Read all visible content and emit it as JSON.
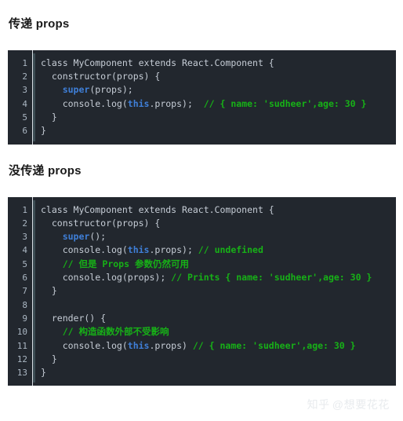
{
  "sections": [
    {
      "heading": "传递 props",
      "code": {
        "line_numbers": [
          "1",
          "2",
          "3",
          "4",
          "5",
          "6"
        ],
        "lines": [
          [
            {
              "t": "class MyComponent extends React.Component {",
              "c": "plain"
            }
          ],
          [
            {
              "t": "  constructor(props) {",
              "c": "plain"
            }
          ],
          [
            {
              "t": "    ",
              "c": "plain"
            },
            {
              "t": "super",
              "c": "kw"
            },
            {
              "t": "(props);",
              "c": "plain"
            }
          ],
          [
            {
              "t": "    console.log(",
              "c": "plain"
            },
            {
              "t": "this",
              "c": "kw"
            },
            {
              "t": ".props);  ",
              "c": "plain"
            },
            {
              "t": "// { name: 'sudheer',age: 30 }",
              "c": "cmt"
            }
          ],
          [
            {
              "t": "  }",
              "c": "plain"
            }
          ],
          [
            {
              "t": "}",
              "c": "plain"
            }
          ]
        ]
      }
    },
    {
      "heading": "没传递 props",
      "code": {
        "line_numbers": [
          "1",
          "2",
          "3",
          "4",
          "5",
          "6",
          "7",
          "8",
          "9",
          "10",
          "11",
          "12",
          "13"
        ],
        "lines": [
          [
            {
              "t": "class MyComponent extends React.Component {",
              "c": "plain"
            }
          ],
          [
            {
              "t": "  constructor(props) {",
              "c": "plain"
            }
          ],
          [
            {
              "t": "    ",
              "c": "plain"
            },
            {
              "t": "super",
              "c": "kw"
            },
            {
              "t": "();",
              "c": "plain"
            }
          ],
          [
            {
              "t": "    console.log(",
              "c": "plain"
            },
            {
              "t": "this",
              "c": "kw"
            },
            {
              "t": ".props); ",
              "c": "plain"
            },
            {
              "t": "// undefined",
              "c": "cmt"
            }
          ],
          [
            {
              "t": "    ",
              "c": "plain"
            },
            {
              "t": "// 但是 Props 参数仍然可用",
              "c": "cmt"
            }
          ],
          [
            {
              "t": "    console.log(props); ",
              "c": "plain"
            },
            {
              "t": "// Prints { name: 'sudheer',age: 30 }",
              "c": "cmt"
            }
          ],
          [
            {
              "t": "  }",
              "c": "plain"
            }
          ],
          [
            {
              "t": "",
              "c": "plain"
            }
          ],
          [
            {
              "t": "  render() {",
              "c": "plain"
            }
          ],
          [
            {
              "t": "    ",
              "c": "plain"
            },
            {
              "t": "// 构造函数外部不受影响",
              "c": "cmt"
            }
          ],
          [
            {
              "t": "    console.log(",
              "c": "plain"
            },
            {
              "t": "this",
              "c": "kw"
            },
            {
              "t": ".props) ",
              "c": "plain"
            },
            {
              "t": "// { name: 'sudheer',age: 30 }",
              "c": "cmt"
            }
          ],
          [
            {
              "t": "  }",
              "c": "plain"
            }
          ],
          [
            {
              "t": "}",
              "c": "plain"
            }
          ]
        ]
      }
    }
  ],
  "watermark": {
    "brand": "知乎",
    "user": "@想要花花"
  },
  "colors": {
    "code_background": "#22272e",
    "page_background": "#ffffff",
    "keyword": "#3f7fd8",
    "comment": "#17b117",
    "code_text": "#c6cdd6",
    "line_number": "#aab6c2",
    "heading_text": "#1a1a1a"
  }
}
